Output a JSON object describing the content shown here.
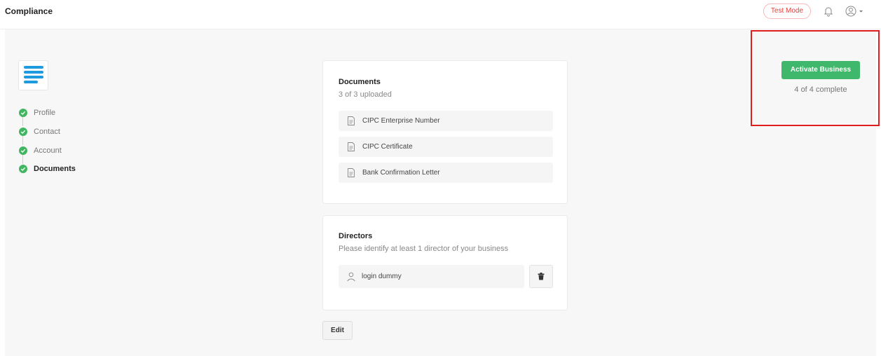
{
  "header": {
    "title": "Compliance",
    "test_mode_label": "Test Mode"
  },
  "sidebar": {
    "steps": [
      {
        "label": "Profile",
        "status": "complete"
      },
      {
        "label": "Contact",
        "status": "complete"
      },
      {
        "label": "Account",
        "status": "complete"
      },
      {
        "label": "Documents",
        "status": "complete",
        "active": true
      }
    ]
  },
  "documents": {
    "title": "Documents",
    "subtitle": "3 of 3 uploaded",
    "items": [
      {
        "label": "CIPC Enterprise Number"
      },
      {
        "label": "CIPC Certificate"
      },
      {
        "label": "Bank Confirmation Letter"
      }
    ]
  },
  "directors": {
    "title": "Directors",
    "subtitle": "Please identify at least 1 director of your business",
    "items": [
      {
        "name": "login dummy"
      }
    ]
  },
  "actions": {
    "edit_label": "Edit",
    "activate_label": "Activate Business",
    "progress_text": "4 of 4 complete"
  },
  "colors": {
    "accent_green": "#40b86b",
    "check_green": "#3fb65f",
    "test_mode_red": "#e0403a",
    "logo_blue": "#1e9bde",
    "highlight_red": "#e01e1e"
  },
  "icons": {
    "bell": "bell-icon",
    "user": "user-circle-icon",
    "document": "document-icon",
    "person": "person-icon",
    "trash": "trash-icon",
    "check": "check-icon"
  }
}
